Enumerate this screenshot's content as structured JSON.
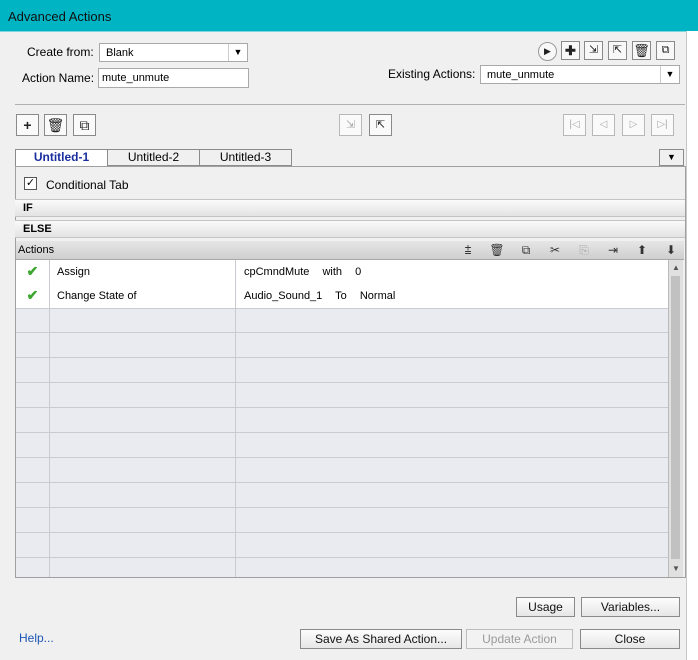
{
  "window": {
    "title": "Advanced Actions"
  },
  "form": {
    "create_from_label": "Create from:",
    "create_from_value": "Blank",
    "action_name_label": "Action Name:",
    "action_name_value": "mute_unmute",
    "existing_actions_label": "Existing Actions:",
    "existing_actions_value": "mute_unmute"
  },
  "tabs": [
    {
      "label": "Untitled-1",
      "active": true
    },
    {
      "label": "Untitled-2",
      "active": false
    },
    {
      "label": "Untitled-3",
      "active": false
    }
  ],
  "conditional": {
    "label": "Conditional Tab",
    "checked": true
  },
  "sections": {
    "if_label": "IF",
    "else_label": "ELSE"
  },
  "actions": {
    "header": "Actions",
    "rows": [
      {
        "status": "valid",
        "action": "Assign",
        "target": "cpCmndMute",
        "op": "with",
        "value": "0"
      },
      {
        "status": "valid",
        "action": "Change State of",
        "target": "Audio_Sound_1",
        "op": "To",
        "value": "Normal"
      }
    ]
  },
  "buttons": {
    "usage": "Usage",
    "variables": "Variables...",
    "save_shared": "Save As Shared Action...",
    "update": "Update Action",
    "close": "Close",
    "help": "Help..."
  },
  "icons": {
    "play": "play-icon",
    "add": "plus-icon",
    "import": "import-icon",
    "export": "export-icon",
    "delete": "trash-icon",
    "duplicate": "duplicate-icon",
    "checkmark": "checkmark-icon"
  }
}
